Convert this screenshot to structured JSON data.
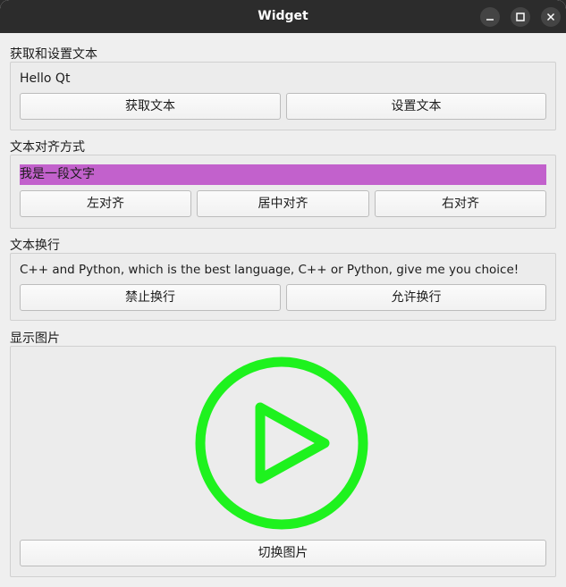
{
  "window": {
    "title": "Widget",
    "minimize_icon": "minimize-icon",
    "maximize_icon": "maximize-icon",
    "close_icon": "close-icon"
  },
  "group_get_set": {
    "title": "获取和设置文本",
    "label_text": "Hello Qt",
    "get_button": "获取文本",
    "set_button": "设置文本"
  },
  "group_align": {
    "title": "文本对齐方式",
    "label_text": "我是一段文字",
    "label_bg_color": "#c261cc",
    "left_button": "左对齐",
    "center_button": "居中对齐",
    "right_button": "右对齐"
  },
  "group_wrap": {
    "title": "文本换行",
    "label_text": "C++ and Python, which is the best language, C++ or Python, give me you choice!",
    "disable_button": "禁止换行",
    "enable_button": "允许换行"
  },
  "group_image": {
    "title": "显示图片",
    "image_icon": "play-icon",
    "image_color": "#1ef21e",
    "switch_button": "切换图片"
  }
}
